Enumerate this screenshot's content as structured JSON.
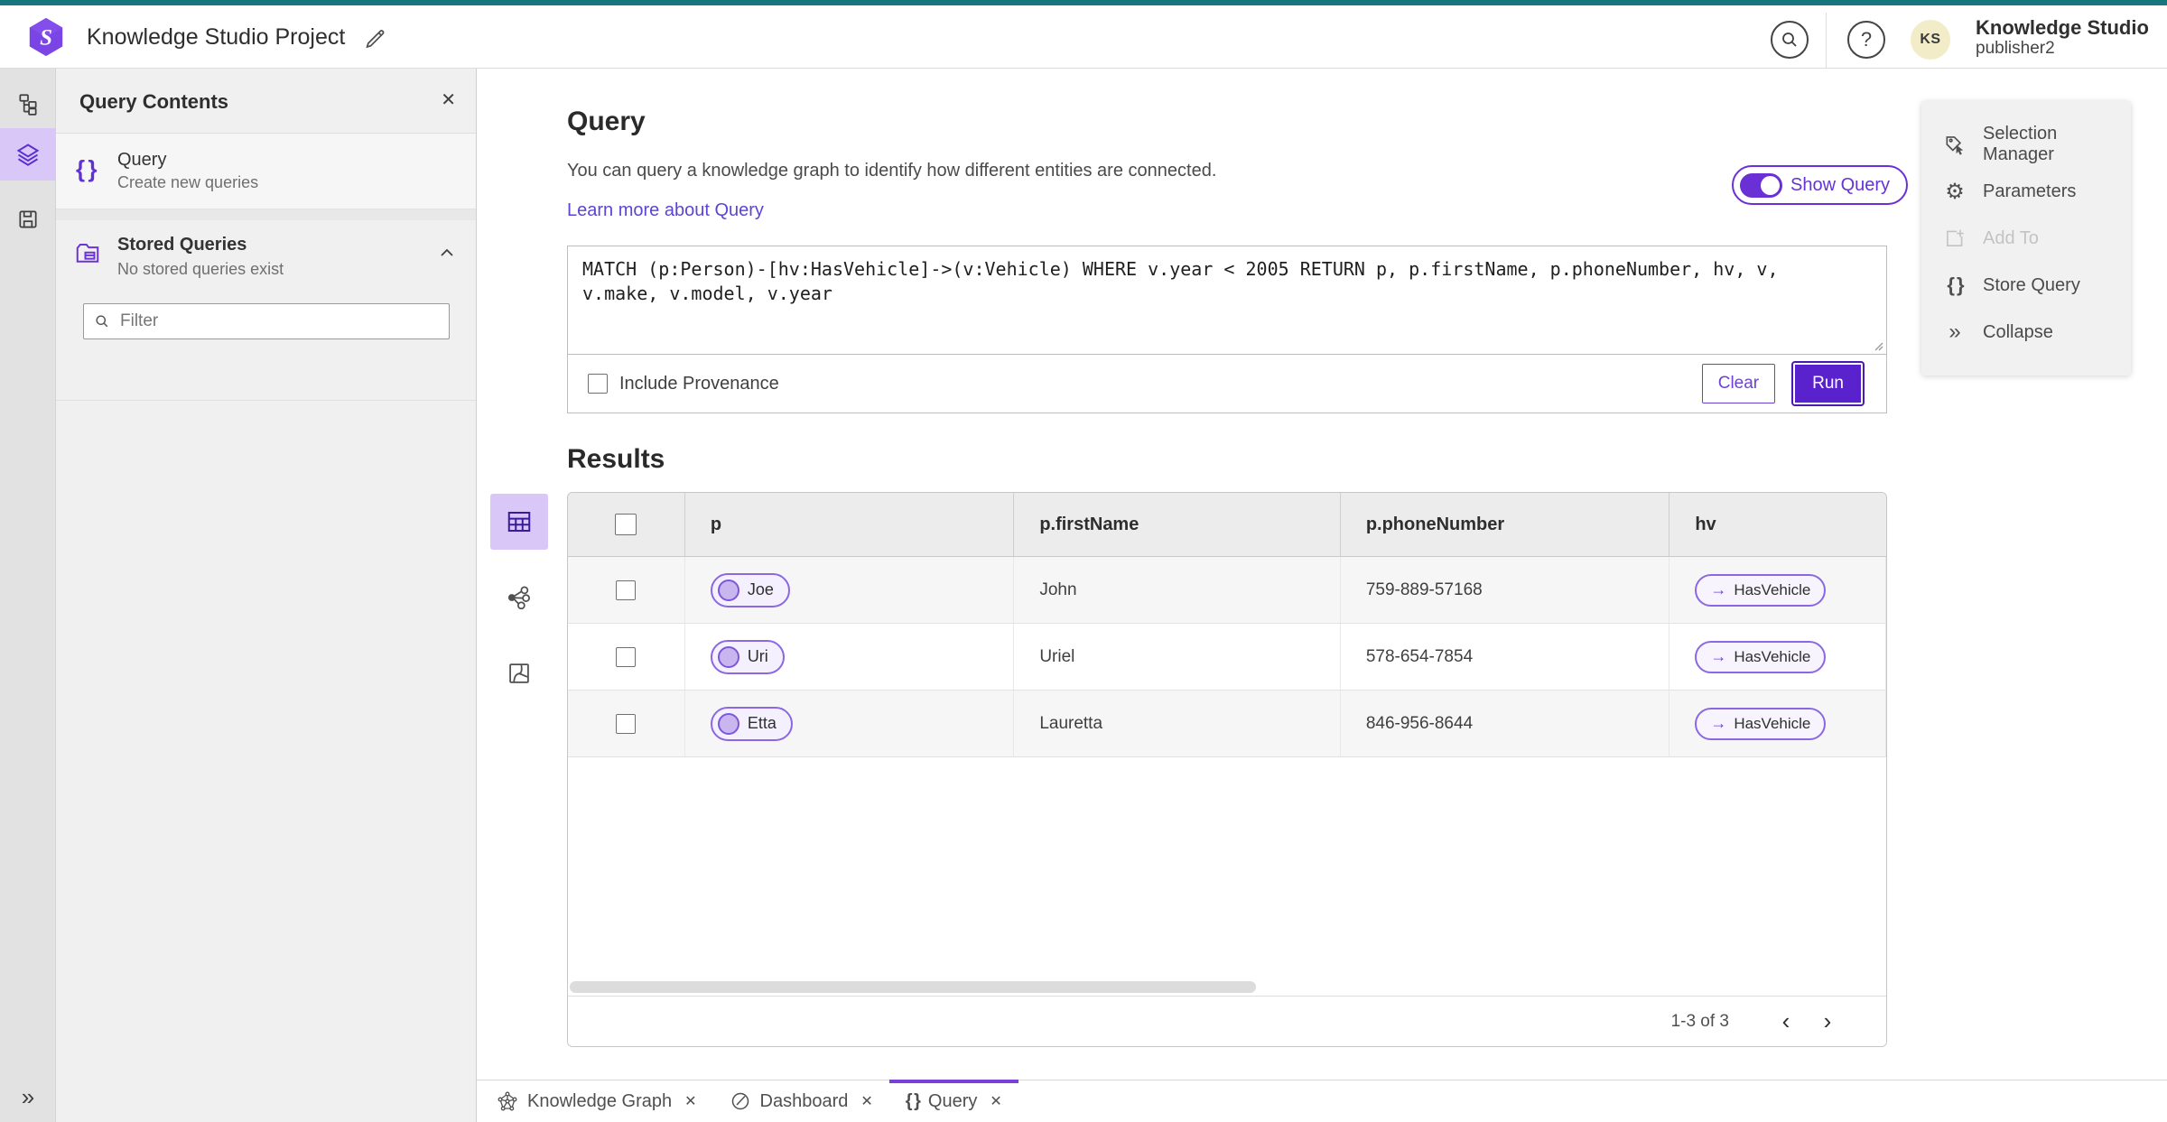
{
  "header": {
    "app_title": "Knowledge Studio Project",
    "account_name": "Knowledge Studio",
    "account_user": "publisher2",
    "avatar_initials": "KS"
  },
  "icons": {
    "close": "✕",
    "help": "?",
    "braces": "{ }",
    "collapse_chevrons": "»",
    "arrow_right": "→",
    "chevron_left": "‹",
    "chevron_right": "›",
    "gear": "⚙"
  },
  "contents_panel": {
    "title": "Query Contents",
    "query_item": {
      "title": "Query",
      "subtitle": "Create new queries"
    },
    "stored": {
      "title": "Stored Queries",
      "subtitle": "No stored queries exist"
    },
    "filter_placeholder": "Filter"
  },
  "query_section": {
    "title": "Query",
    "description": "You can query a knowledge graph to identify how different entities are connected.",
    "learn_more": "Learn more about Query",
    "show_query_label": "Show Query",
    "query_text": "MATCH (p:Person)-[hv:HasVehicle]->(v:Vehicle) WHERE v.year < 2005 RETURN p, p.firstName, p.phoneNumber, hv, v, v.make, v.model, v.year",
    "include_provenance_label": "Include Provenance",
    "clear_label": "Clear",
    "run_label": "Run"
  },
  "results": {
    "title": "Results",
    "columns": [
      "p",
      "p.firstName",
      "p.phoneNumber",
      "hv"
    ],
    "rows": [
      {
        "entity": "Joe",
        "firstName": "John",
        "phone": "759-889-57168",
        "rel": "HasVehicle"
      },
      {
        "entity": "Uri",
        "firstName": "Uriel",
        "phone": "578-654-7854",
        "rel": "HasVehicle"
      },
      {
        "entity": "Etta",
        "firstName": "Lauretta",
        "phone": "846-956-8644",
        "rel": "HasVehicle"
      }
    ],
    "pagination": {
      "range": "1-3 of 3"
    }
  },
  "right_menu": {
    "items": [
      {
        "label": "Selection Manager",
        "disabled": false
      },
      {
        "label": "Parameters",
        "disabled": false
      },
      {
        "label": "Add To",
        "disabled": true
      },
      {
        "label": "Store Query",
        "disabled": false
      },
      {
        "label": "Collapse",
        "disabled": false
      }
    ]
  },
  "tabbar": {
    "tabs": [
      {
        "label": "Knowledge Graph",
        "active": false
      },
      {
        "label": "Dashboard",
        "active": false
      },
      {
        "label": "Query",
        "active": true
      }
    ]
  },
  "colors": {
    "accent_purple": "#5a22cc",
    "selected_purple_bg": "#d9c7f8",
    "pill_border": "#8b68e2",
    "top_strip_teal": "#17767d",
    "link_purple": "#5b45d5",
    "avatar_bg": "#f2edc8"
  }
}
